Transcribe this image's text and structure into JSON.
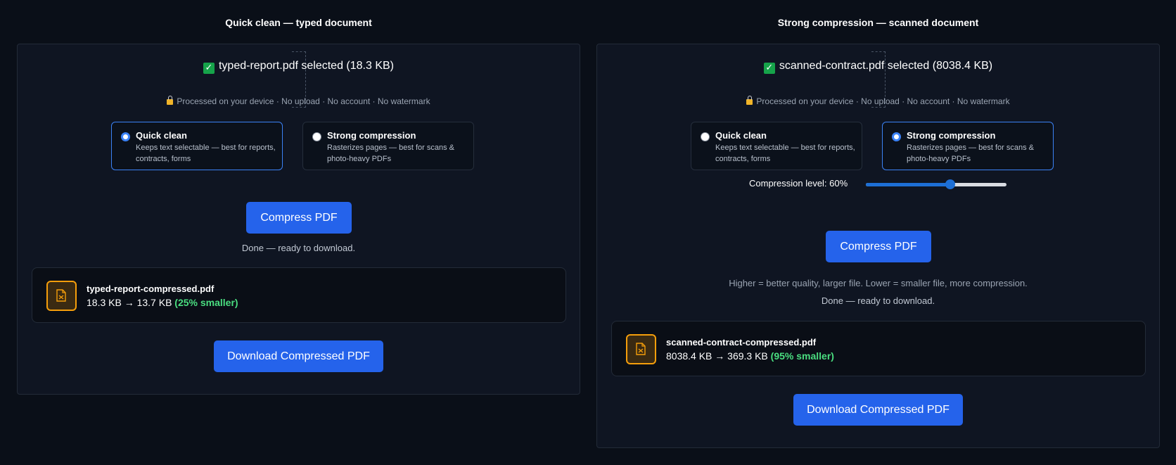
{
  "left": {
    "title": "Quick clean — typed document",
    "selected_file": "typed-report.pdf selected (18.3 KB)",
    "privacy": "Processed on your device · No upload · No account · No watermark",
    "options": [
      {
        "title": "Quick clean",
        "desc": "Keeps text selectable — best for reports, contracts, forms",
        "selected": true
      },
      {
        "title": "Strong compression",
        "desc": "Rasterizes pages — best for scans & photo-heavy PDFs",
        "selected": false
      }
    ],
    "compress_label": "Compress PDF",
    "status": "Done — ready to download.",
    "result": {
      "filename": "typed-report-compressed.pdf",
      "sizes": "18.3 KB → 13.7 KB",
      "savings": "(25% smaller)"
    },
    "download_label": "Download Compressed PDF"
  },
  "right": {
    "title": "Strong compression — scanned document",
    "selected_file": "scanned-contract.pdf selected (8038.4 KB)",
    "privacy": "Processed on your device · No upload · No account · No watermark",
    "options": [
      {
        "title": "Quick clean",
        "desc": "Keeps text selectable — best for reports, contracts, forms",
        "selected": false
      },
      {
        "title": "Strong compression",
        "desc": "Rasterizes pages — best for scans & photo-heavy PDFs",
        "selected": true
      }
    ],
    "slider_label": "Compression level: 60%",
    "slider_value": 60,
    "compress_label": "Compress PDF",
    "hint": "Higher = better quality, larger file. Lower = smaller file, more compression.",
    "status": "Done — ready to download.",
    "result": {
      "filename": "scanned-contract-compressed.pdf",
      "sizes": "8038.4 KB → 369.3 KB",
      "savings": "(95% smaller)"
    },
    "download_label": "Download Compressed PDF"
  },
  "icons": {
    "check": "check-icon",
    "lock": "lock-icon",
    "file": "compressed-file-icon"
  },
  "colors": {
    "accent": "#2563eb",
    "success": "#4ade80",
    "file_icon": "#f59e0b",
    "background": "#0a0f18"
  }
}
